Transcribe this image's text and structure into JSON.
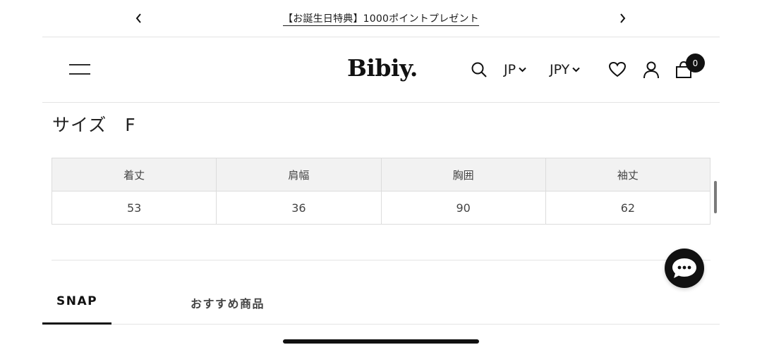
{
  "announcement": {
    "text": "【お誕生日特典】1000ポイントプレゼント",
    "prev_icon": "chevron-left-icon",
    "next_icon": "chevron-right-icon"
  },
  "header": {
    "logo": "Bibiy.",
    "language": "JP",
    "currency": "JPY",
    "cart_count": "0"
  },
  "size_section": {
    "title": "サイズ　F",
    "columns": [
      "着丈",
      "肩幅",
      "胸囲",
      "袖丈"
    ],
    "values": [
      "53",
      "36",
      "90",
      "62"
    ]
  },
  "tabs": [
    {
      "label": "SNAP",
      "active": true
    },
    {
      "label": "おすすめ商品",
      "active": false
    }
  ],
  "colors": {
    "accent": "#111111",
    "table_header_bg": "#f2f2f2",
    "border": "#dcdcdc"
  }
}
